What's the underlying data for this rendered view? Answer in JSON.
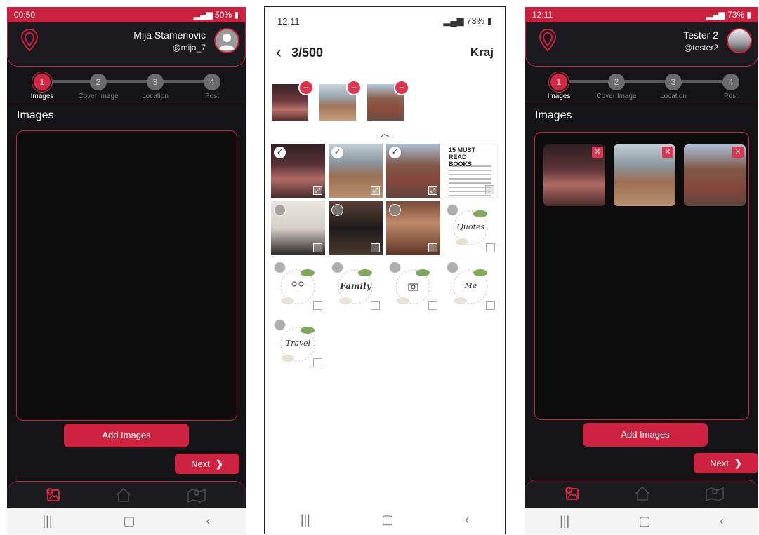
{
  "phone1": {
    "status": {
      "time": "00:50",
      "battery": "50%"
    },
    "user": {
      "name": "Mija Stamenovic",
      "handle": "@mija_7"
    },
    "steps": [
      {
        "num": "1",
        "label": "Images"
      },
      {
        "num": "2",
        "label": "Cover Image"
      },
      {
        "num": "3",
        "label": "Location"
      },
      {
        "num": "4",
        "label": "Post"
      }
    ],
    "section_title": "Images",
    "add_images": "Add Images",
    "next": "Next"
  },
  "phone2": {
    "status": {
      "time": "12:11",
      "battery": "73%"
    },
    "count": "3/500",
    "done": "Kraj",
    "books_title": "15 MUST READ BOOKS",
    "script_labels": {
      "quotes": "Quotes",
      "family": "Family",
      "me": "Me",
      "travel": "Travel"
    }
  },
  "phone3": {
    "status": {
      "time": "12:11",
      "battery": "73%"
    },
    "user": {
      "name": "Tester 2",
      "handle": "@tester2"
    },
    "steps": [
      {
        "num": "1",
        "label": "Images"
      },
      {
        "num": "2",
        "label": "Cover Image"
      },
      {
        "num": "3",
        "label": "Location"
      },
      {
        "num": "4",
        "label": "Post"
      }
    ],
    "section_title": "Images",
    "add_images": "Add Images",
    "next": "Next"
  },
  "colors": {
    "accent": "#cf2240",
    "background": "#141316"
  },
  "icons": [
    "location-pin-logo-icon",
    "add-image-icon",
    "home-icon",
    "map-icon",
    "back-arrow-icon",
    "check-icon",
    "minus-icon",
    "expand-icon",
    "close-icon"
  ]
}
